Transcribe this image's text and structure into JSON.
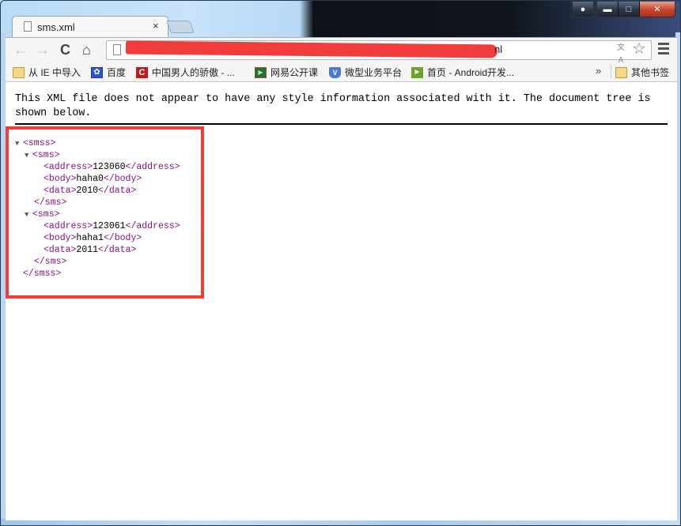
{
  "window": {
    "controls": {
      "profile_icon": "person-icon",
      "minimize_icon": "minimize-icon",
      "maximize_icon": "maximize-icon",
      "close_icon": "close-icon"
    }
  },
  "tab": {
    "title": "sms.xml",
    "close_glyph": "×"
  },
  "toolbar": {
    "back_glyph": "←",
    "forward_glyph": "→",
    "reload_glyph": "C",
    "home_glyph": "⌂",
    "url_visible_tail": "nl",
    "url_redacted": true,
    "star_glyph": "☆"
  },
  "bookmarks": {
    "items": [
      {
        "label": "从 IE 中导入",
        "icon": "folder-icon"
      },
      {
        "label": "百度",
        "icon": "baidu-paw-icon"
      },
      {
        "label": "中国男人的骄傲 - ...",
        "icon": "c-logo-icon"
      },
      {
        "label": "网易公开课",
        "icon": "play-icon"
      },
      {
        "label": "微型业务平台",
        "icon": "v-shield-icon"
      },
      {
        "label": "首页 - Android开发...",
        "icon": "android-site-icon"
      }
    ],
    "overflow_glyph": "»",
    "other_label": "其他书签"
  },
  "page": {
    "notice": "This XML file does not appear to have any style information associated with it. The document tree is shown below.",
    "tree": {
      "root_open": "<smss>",
      "root_close": "</smss>",
      "collapse_glyph": "▼",
      "sms": [
        {
          "open": "<sms>",
          "close": "</sms>",
          "fields": [
            {
              "open": "<address>",
              "value": "123060",
              "close": "</address>"
            },
            {
              "open": "<body>",
              "value": "haha0",
              "close": "</body>"
            },
            {
              "open": "<data>",
              "value": "2010",
              "close": "</data>"
            }
          ]
        },
        {
          "open": "<sms>",
          "close": "</sms>",
          "fields": [
            {
              "open": "<address>",
              "value": "123061",
              "close": "</address>"
            },
            {
              "open": "<body>",
              "value": "haha1",
              "close": "</body>"
            },
            {
              "open": "<data>",
              "value": "2011",
              "close": "</data>"
            }
          ]
        }
      ]
    }
  },
  "colors": {
    "annotation_box": "#f23b3b",
    "xml_tag": "#881280",
    "xml_text": "#000000"
  }
}
